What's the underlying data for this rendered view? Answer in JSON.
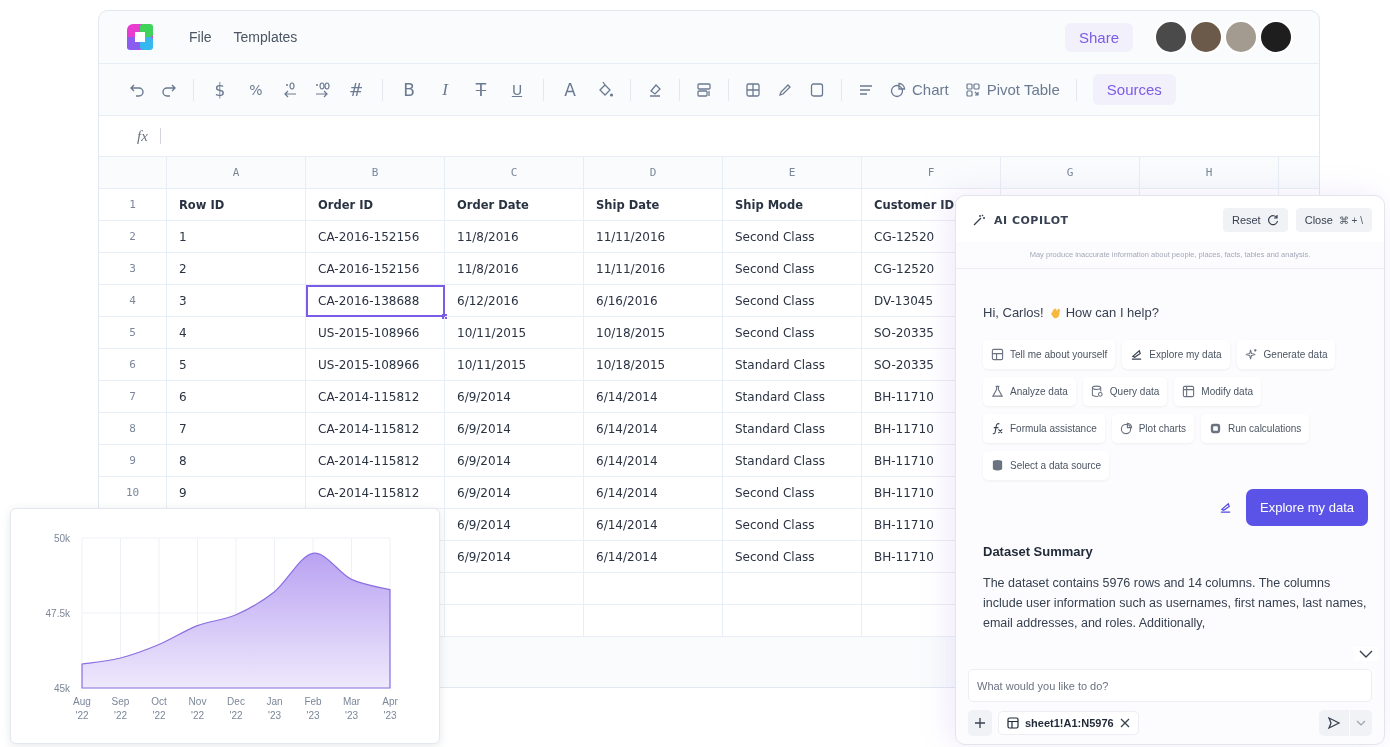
{
  "menu": [
    {
      "label": "File"
    },
    {
      "label": "Templates"
    }
  ],
  "share": "Share",
  "toolbar": {
    "glyphs": [
      "$",
      "%",
      "#",
      "B",
      "I",
      "T",
      "U",
      "A"
    ],
    "tools": [
      {
        "label": "Chart"
      },
      {
        "label": "Pivot Table"
      }
    ],
    "sources": "Sources"
  },
  "formula_bar": {
    "label": "fx"
  },
  "sheet": {
    "columns": [
      "A",
      "B",
      "C",
      "D",
      "E",
      "F",
      "G",
      "H"
    ],
    "rows": [
      {
        "number": "1",
        "kind": "header",
        "cells": [
          {
            "text": "Row ID",
            "selected": false
          },
          {
            "text": "Order ID",
            "selected": false
          },
          {
            "text": "Order Date",
            "selected": false
          },
          {
            "text": "Ship Date",
            "selected": false
          },
          {
            "text": "Ship Mode",
            "selected": false
          },
          {
            "text": "Customer ID",
            "selected": false
          }
        ]
      },
      {
        "number": "2",
        "kind": "data",
        "cells": [
          {
            "text": "1",
            "selected": false
          },
          {
            "text": "CA-2016-152156",
            "selected": false
          },
          {
            "text": "11/8/2016",
            "selected": false
          },
          {
            "text": "11/11/2016",
            "selected": false
          },
          {
            "text": "Second Class",
            "selected": false
          },
          {
            "text": "CG-12520",
            "selected": false
          }
        ]
      },
      {
        "number": "3",
        "kind": "data",
        "cells": [
          {
            "text": "2",
            "selected": false
          },
          {
            "text": "CA-2016-152156",
            "selected": false
          },
          {
            "text": "11/8/2016",
            "selected": false
          },
          {
            "text": "11/11/2016",
            "selected": false
          },
          {
            "text": "Second Class",
            "selected": false
          },
          {
            "text": "CG-12520",
            "selected": false
          }
        ]
      },
      {
        "number": "4",
        "kind": "data",
        "cells": [
          {
            "text": "3",
            "selected": false
          },
          {
            "text": "CA-2016-138688",
            "selected": true
          },
          {
            "text": "6/12/2016",
            "selected": false
          },
          {
            "text": "6/16/2016",
            "selected": false
          },
          {
            "text": "Second Class",
            "selected": false
          },
          {
            "text": "DV-13045",
            "selected": false
          }
        ]
      },
      {
        "number": "5",
        "kind": "data",
        "cells": [
          {
            "text": "4",
            "selected": false
          },
          {
            "text": "US-2015-108966",
            "selected": false
          },
          {
            "text": "10/11/2015",
            "selected": false
          },
          {
            "text": "10/18/2015",
            "selected": false
          },
          {
            "text": "Second Class",
            "selected": false
          },
          {
            "text": "SO-20335",
            "selected": false
          }
        ]
      },
      {
        "number": "6",
        "kind": "data",
        "cells": [
          {
            "text": "5",
            "selected": false
          },
          {
            "text": "US-2015-108966",
            "selected": false
          },
          {
            "text": "10/11/2015",
            "selected": false
          },
          {
            "text": "10/18/2015",
            "selected": false
          },
          {
            "text": "Standard Class",
            "selected": false
          },
          {
            "text": "SO-20335",
            "selected": false
          }
        ]
      },
      {
        "number": "7",
        "kind": "data",
        "cells": [
          {
            "text": "6",
            "selected": false
          },
          {
            "text": "CA-2014-115812",
            "selected": false
          },
          {
            "text": "6/9/2014",
            "selected": false
          },
          {
            "text": "6/14/2014",
            "selected": false
          },
          {
            "text": "Standard Class",
            "selected": false
          },
          {
            "text": "BH-11710",
            "selected": false
          }
        ]
      },
      {
        "number": "8",
        "kind": "data",
        "cells": [
          {
            "text": "7",
            "selected": false
          },
          {
            "text": "CA-2014-115812",
            "selected": false
          },
          {
            "text": "6/9/2014",
            "selected": false
          },
          {
            "text": "6/14/2014",
            "selected": false
          },
          {
            "text": "Standard Class",
            "selected": false
          },
          {
            "text": "BH-11710",
            "selected": false
          }
        ]
      },
      {
        "number": "9",
        "kind": "data",
        "cells": [
          {
            "text": "8",
            "selected": false
          },
          {
            "text": "CA-2014-115812",
            "selected": false
          },
          {
            "text": "6/9/2014",
            "selected": false
          },
          {
            "text": "6/14/2014",
            "selected": false
          },
          {
            "text": "Standard Class",
            "selected": false
          },
          {
            "text": "BH-11710",
            "selected": false
          }
        ]
      },
      {
        "number": "10",
        "kind": "data",
        "cells": [
          {
            "text": "9",
            "selected": false
          },
          {
            "text": "CA-2014-115812",
            "selected": false
          },
          {
            "text": "6/9/2014",
            "selected": false
          },
          {
            "text": "6/14/2014",
            "selected": false
          },
          {
            "text": "Second Class",
            "selected": false
          },
          {
            "text": "BH-11710",
            "selected": false
          }
        ]
      },
      {
        "kind": "data",
        "cells": [
          null,
          null,
          {
            "text": "6/9/2014",
            "selected": false
          },
          {
            "text": "6/14/2014",
            "selected": false
          },
          {
            "text": "Second Class",
            "selected": false
          },
          {
            "text": "BH-11710",
            "selected": false
          }
        ]
      },
      {
        "kind": "data",
        "cells": [
          null,
          null,
          {
            "text": "6/9/2014",
            "selected": false
          },
          {
            "text": "6/14/2014",
            "selected": false
          },
          {
            "text": "Second Class",
            "selected": false
          },
          {
            "text": "BH-11710",
            "selected": false
          }
        ]
      }
    ]
  },
  "chart_card": {
    "chart_data": {
      "type": "area",
      "categories": [
        "Aug '22",
        "Sep '22",
        "Oct '22",
        "Nov '22",
        "Dec '22",
        "Jan '23",
        "Feb '23",
        "Mar '23",
        "Apr '23"
      ],
      "grid": true,
      "series": [
        {
          "color": "#8b6fe0",
          "values": [
            45800,
            46000,
            46450,
            47080,
            47440,
            48210,
            49490,
            48620,
            48280
          ]
        }
      ],
      "ylim": [
        45000,
        50000
      ],
      "yticks": [
        {
          "value": 45000,
          "label": "45k"
        },
        {
          "value": 47500,
          "label": "47.5k"
        },
        {
          "value": 50000,
          "label": "50k"
        }
      ]
    }
  },
  "copilot": {
    "title": "AI COPILOT",
    "reset": "Reset",
    "close": "Close",
    "close_shortcut": "⌘ + \\",
    "disclaimer": "May produce inaccurate information about people, places, facts, tables and analysis.",
    "greeting": "Hi, Carlos!",
    "greeting_question": "How can I help?",
    "suggestions": [
      {
        "label": "Tell me about yourself"
      },
      {
        "label": "Explore my data"
      },
      {
        "label": "Generate data"
      },
      {
        "label": "Analyze data"
      },
      {
        "label": "Query data"
      },
      {
        "label": "Modify data"
      },
      {
        "label": "Formula assistance"
      },
      {
        "label": "Plot charts"
      },
      {
        "label": "Run calculations"
      },
      {
        "label": "Select a data source"
      }
    ],
    "user_message": "Explore my data",
    "summary_title": "Dataset Summary",
    "summary_text": "The dataset contains 5976 rows and 14 columns. The columns include user information such as usernames, first names, last names, email addresses, and roles. Additionally,",
    "input": {
      "placeholder": "What would you like to do?"
    },
    "attachment": "sheet1!A1:N5976"
  }
}
